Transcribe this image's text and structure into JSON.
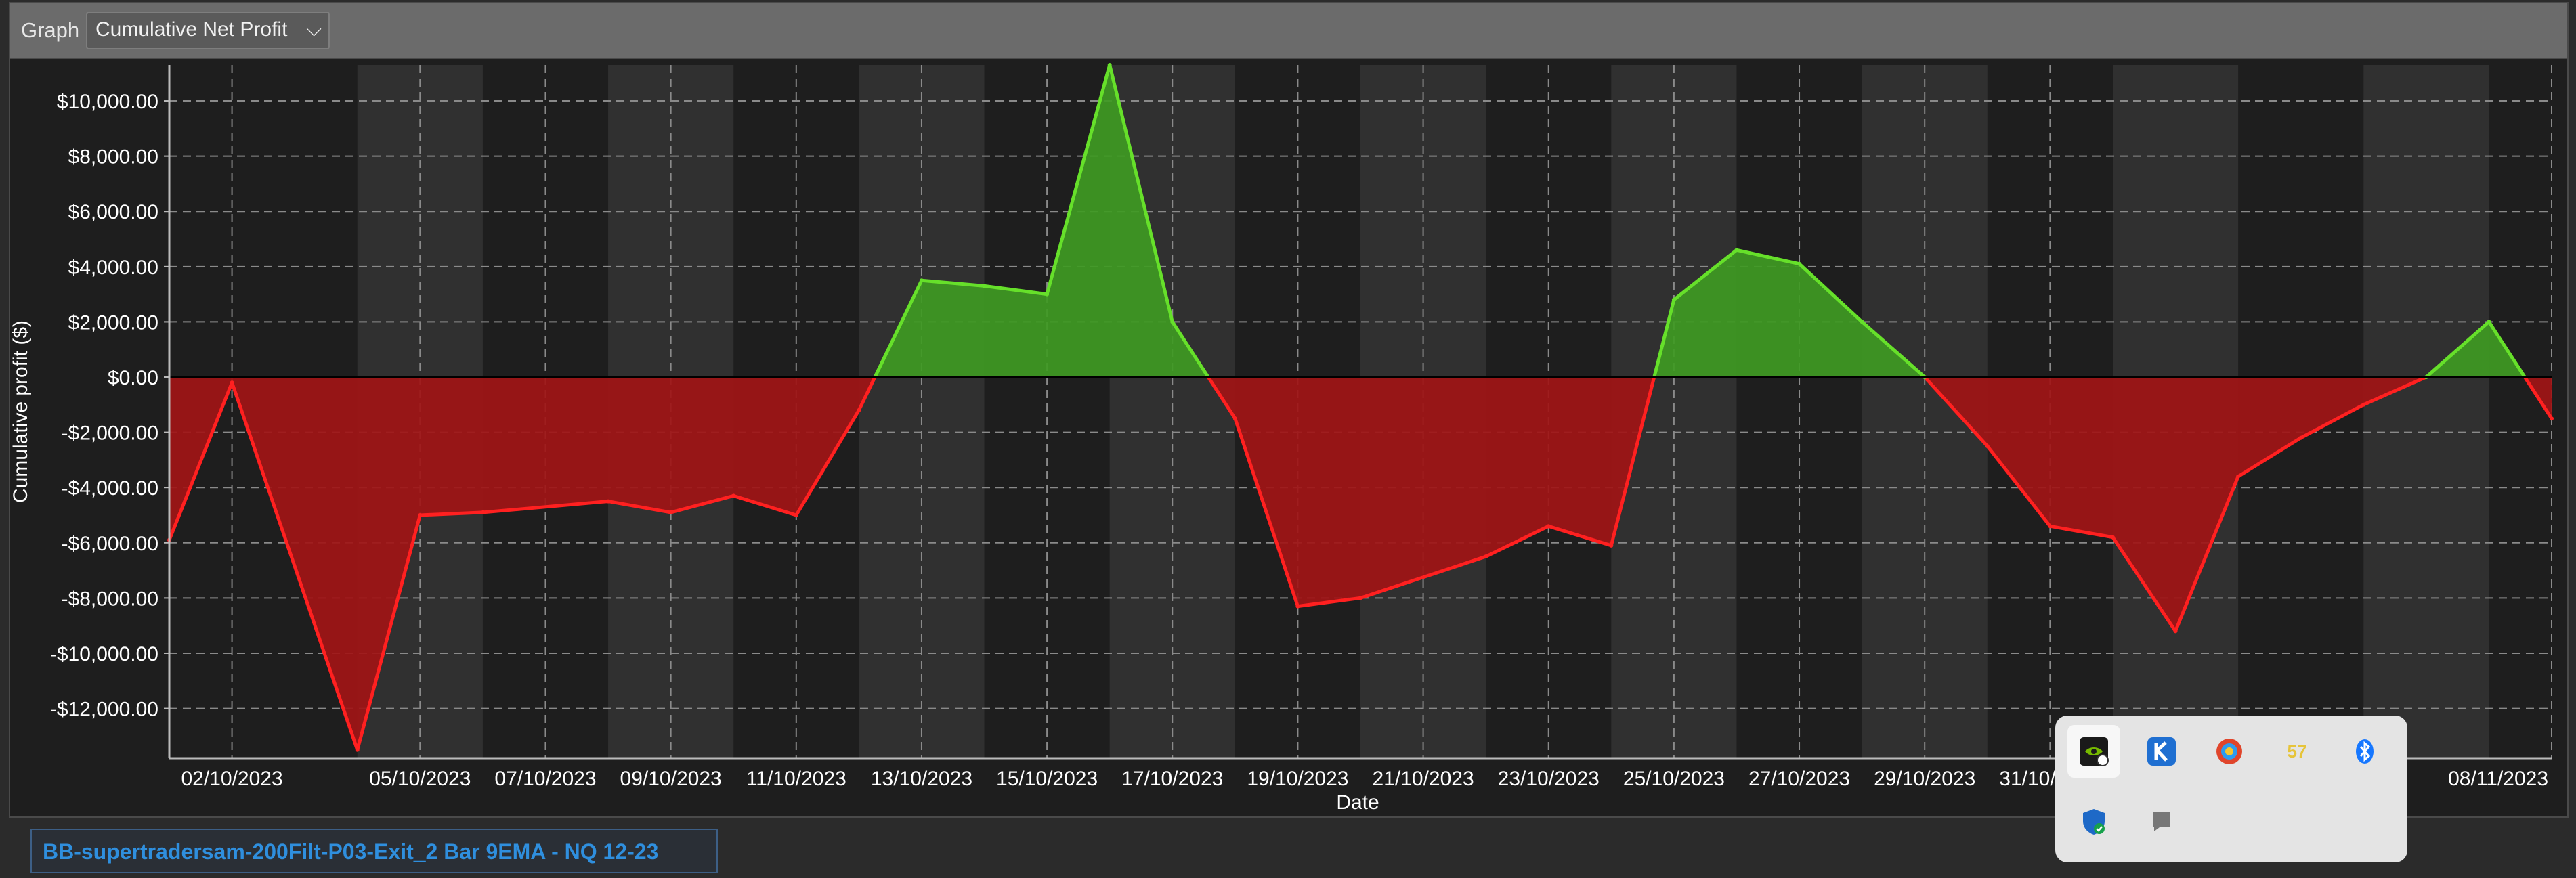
{
  "toolbar": {
    "graph_label": "Graph",
    "selected_metric": "Cumulative Net Profit"
  },
  "bottom": {
    "strategy_tab": "BB-supertradersam-200Filt-P03-Exit_2 Bar 9EMA - NQ 12-23"
  },
  "tray": {
    "badge_text": "57"
  },
  "colors": {
    "profit_fill": "#3f9a23",
    "profit_line": "#66e02a",
    "loss_fill": "#a11516",
    "loss_line": "#ff2020"
  },
  "chart_data": {
    "type": "area",
    "ylabel": "Cumulative profit ($)",
    "xlabel": "Date",
    "ylim": [
      -13800,
      11300
    ],
    "grid": true,
    "yticks": [
      -12000,
      -10000,
      -8000,
      -6000,
      -4000,
      -2000,
      0,
      2000,
      4000,
      6000,
      8000,
      10000
    ],
    "ytick_labels": [
      "-$12,000.00",
      "-$10,000.00",
      "-$8,000.00",
      "-$6,000.00",
      "-$4,000.00",
      "-$2,000.00",
      "$0.00",
      "$2,000.00",
      "$4,000.00",
      "$6,000.00",
      "$8,000.00",
      "$10,000.00"
    ],
    "xlim": [
      "2023-10-01",
      "2023-11-08"
    ],
    "xtick_labels": [
      "02/10/2023",
      "05/10/2023",
      "07/10/2023",
      "09/10/2023",
      "11/10/2023",
      "13/10/2023",
      "15/10/2023",
      "17/10/2023",
      "19/10/2023",
      "21/10/2023",
      "23/10/2023",
      "25/10/2023",
      "27/10/2023",
      "29/10/2023",
      "31/10/2023",
      "08/11/2023"
    ],
    "x": [
      "2023-10-01",
      "2023-10-02",
      "2023-10-04",
      "2023-10-05",
      "2023-10-06",
      "2023-10-08",
      "2023-10-09",
      "2023-10-10",
      "2023-10-11",
      "2023-10-12",
      "2023-10-13",
      "2023-10-14",
      "2023-10-15",
      "2023-10-16",
      "2023-10-17",
      "2023-10-18",
      "2023-10-19",
      "2023-10-20",
      "2023-10-22",
      "2023-10-23",
      "2023-10-24",
      "2023-10-25",
      "2023-10-26",
      "2023-10-27",
      "2023-10-28",
      "2023-10-29",
      "2023-10-30",
      "2023-10-31",
      "2023-11-01",
      "2023-11-02",
      "2023-11-03",
      "2023-11-04",
      "2023-11-05",
      "2023-11-06",
      "2023-11-07",
      "2023-11-08"
    ],
    "y": [
      -5900,
      -200,
      -13500,
      -5000,
      -4900,
      -4500,
      -4900,
      -4300,
      -5000,
      -1200,
      3500,
      3300,
      3000,
      11300,
      2000,
      -1500,
      -8300,
      -8000,
      -6500,
      -5400,
      -6100,
      2800,
      4600,
      4100,
      2000,
      0,
      -2500,
      -5400,
      -5800,
      -9200,
      -3600,
      -2200,
      -1000,
      0,
      2000,
      -1500
    ]
  }
}
